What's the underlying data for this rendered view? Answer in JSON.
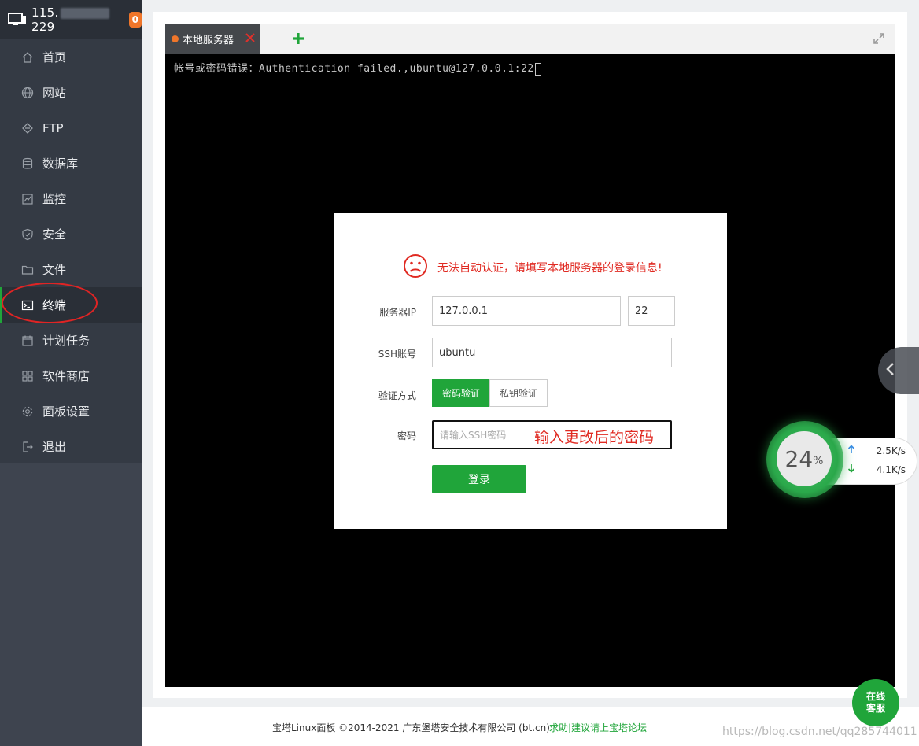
{
  "sidebar": {
    "ip_prefix": "115.",
    "ip_suffix": "229",
    "badge": "0",
    "items": [
      {
        "label": "首页",
        "icon": "home-icon"
      },
      {
        "label": "网站",
        "icon": "globe-icon"
      },
      {
        "label": "FTP",
        "icon": "ftp-icon"
      },
      {
        "label": "数据库",
        "icon": "database-icon"
      },
      {
        "label": "监控",
        "icon": "monitor-chart-icon"
      },
      {
        "label": "安全",
        "icon": "shield-icon"
      },
      {
        "label": "文件",
        "icon": "folder-icon"
      },
      {
        "label": "终端",
        "icon": "terminal-icon"
      },
      {
        "label": "计划任务",
        "icon": "calendar-icon"
      },
      {
        "label": "软件商店",
        "icon": "apps-icon"
      },
      {
        "label": "面板设置",
        "icon": "gear-icon"
      },
      {
        "label": "退出",
        "icon": "logout-icon"
      }
    ],
    "active_item": "终端"
  },
  "tabs": {
    "active_tab_label": "本地服务器"
  },
  "terminal": {
    "line": "帐号或密码错误：Authentication failed.,ubuntu@127.0.0.1:22"
  },
  "dialog": {
    "warning": "无法自动认证，请填写本地服务器的登录信息!",
    "server_ip_label": "服务器IP",
    "server_ip_value": "127.0.0.1",
    "port_value": "22",
    "ssh_account_label": "SSH账号",
    "ssh_account_value": "ubuntu",
    "auth_method_label": "验证方式",
    "auth_password": "密码验证",
    "auth_key": "私钥验证",
    "password_label": "密码",
    "password_placeholder": "请输入SSH密码",
    "password_annotation": "输入更改后的密码",
    "login_button": "登录"
  },
  "monitor": {
    "percent": "24",
    "percent_unit": "%",
    "upload_speed": "2.5K/s",
    "download_speed": "4.1K/s"
  },
  "footer": {
    "copyright": "宝塔Linux面板 ©2014-2021 广东堡塔安全技术有限公司 (bt.cn)",
    "forum_link": "求助|建议请上宝塔论坛",
    "watermark": "https://blog.csdn.net/qq285744011"
  },
  "online_service": {
    "line1": "在线",
    "line2": "客服"
  },
  "colors": {
    "accent_green": "#20a53a",
    "warning_red": "#e02a22",
    "sidebar_bg": "#343a44",
    "tab_dot": "#f0762a"
  }
}
